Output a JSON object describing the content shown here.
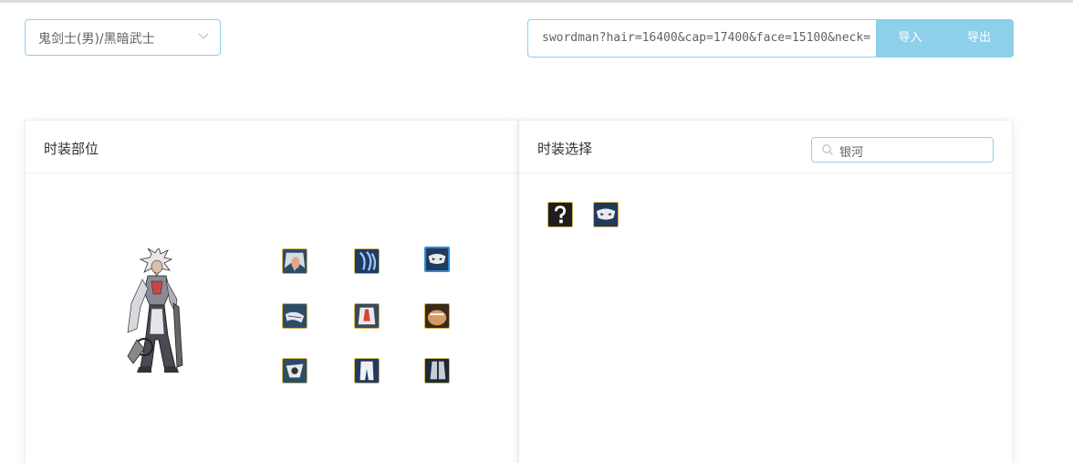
{
  "job_select": {
    "value": "鬼剑士(男)/黑暗武士",
    "icon": "chevron-down-icon"
  },
  "code": {
    "value": "swordman?hair=16400&cap=17400&face=15100&neck="
  },
  "buttons": {
    "import": "导入",
    "export": "导出"
  },
  "left_panel": {
    "title": "时装部位",
    "slots": [
      {
        "part": "hair",
        "icon": "hair-icon"
      },
      {
        "part": "cap",
        "icon": "cap-icon"
      },
      {
        "part": "face",
        "icon": "face-icon",
        "selected": true
      },
      {
        "part": "neck",
        "icon": "neck-icon"
      },
      {
        "part": "coat",
        "icon": "coat-icon"
      },
      {
        "part": "skin",
        "icon": "skin-icon"
      },
      {
        "part": "belt",
        "icon": "belt-icon"
      },
      {
        "part": "pants",
        "icon": "pants-icon"
      },
      {
        "part": "shoes",
        "icon": "shoes-icon"
      }
    ]
  },
  "right_panel": {
    "title": "时装选择",
    "search_value": "银河",
    "results": [
      {
        "icon": "unknown-item-icon"
      },
      {
        "icon": "mask-item-icon"
      }
    ]
  },
  "colors": {
    "accent": "#8ed0ea",
    "border": "#8fd0ea",
    "selected": "#2a8ce0",
    "slot_frame": "#d4b454"
  }
}
